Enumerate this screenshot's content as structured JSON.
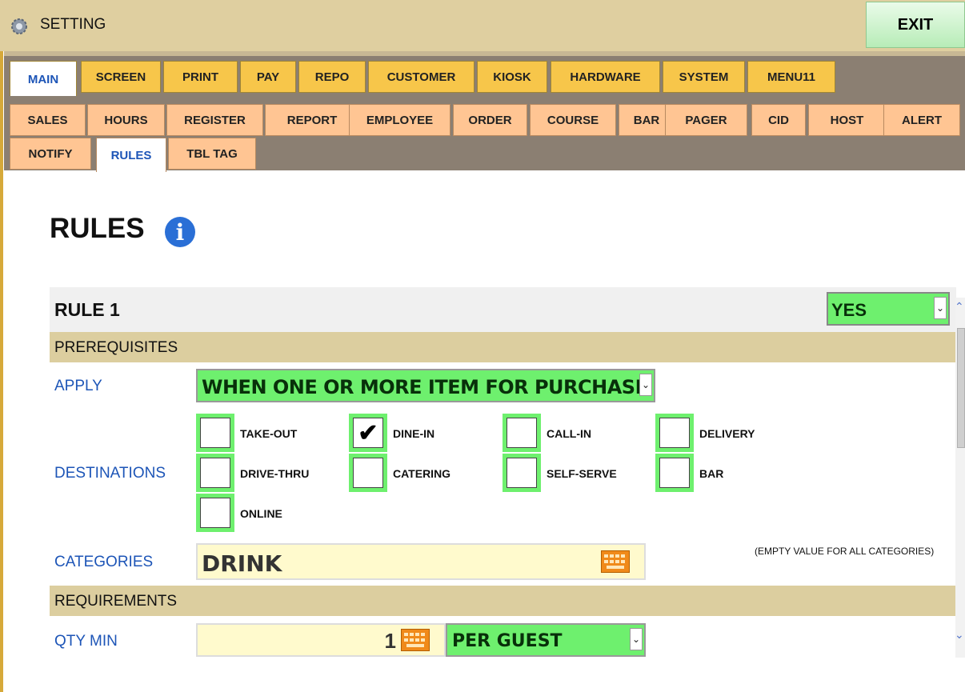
{
  "window": {
    "title": "SETTING",
    "exit_label": "EXIT"
  },
  "main_tabs": [
    "MAIN",
    "SCREEN",
    "PRINT",
    "PAY",
    "REPO",
    "CUSTOMER",
    "KIOSK",
    "HARDWARE",
    "SYSTEM",
    "MENU11"
  ],
  "main_tab_active": "MAIN",
  "sub_tabs": [
    "SALES",
    "HOURS",
    "REGISTER",
    "REPORT",
    "EMPLOYEE",
    "ORDER",
    "COURSE",
    "BAR",
    "PAGER",
    "CID",
    "HOST",
    "ALERT",
    "NOTIFY",
    "RULES",
    "TBL TAG"
  ],
  "sub_tab_active": "RULES",
  "page": {
    "heading": "RULES",
    "info_icon": "info-icon"
  },
  "rule": {
    "title": "RULE 1",
    "enabled": "YES",
    "prerequisites_label": "PREREQUISITES",
    "apply_label": "APPLY",
    "apply_value": "WHEN ONE OR MORE ITEM FOR PURCHASE",
    "destinations_label": "DESTINATIONS",
    "destinations": [
      {
        "label": "TAKE-OUT",
        "checked": false
      },
      {
        "label": "DINE-IN",
        "checked": true
      },
      {
        "label": "CALL-IN",
        "checked": false
      },
      {
        "label": "DELIVERY",
        "checked": false
      },
      {
        "label": "DRIVE-THRU",
        "checked": false
      },
      {
        "label": "CATERING",
        "checked": false
      },
      {
        "label": "SELF-SERVE",
        "checked": false
      },
      {
        "label": "BAR",
        "checked": false
      },
      {
        "label": "ONLINE",
        "checked": false
      }
    ],
    "categories_label": "CATEGORIES",
    "categories_value": "DRINK",
    "categories_note": "(EMPTY VALUE FOR ALL CATEGORIES)",
    "requirements_label": "REQUIREMENTS",
    "qty_min_label": "QTY MIN",
    "qty_min_value": "1",
    "qty_min_unit": "PER GUEST"
  },
  "colors": {
    "accent_green": "#6ef06e",
    "tab_yellow": "#f7c64a",
    "subtab_orange": "#ffc593",
    "section_tan": "#dcce9f",
    "link_blue": "#1d55b7"
  }
}
